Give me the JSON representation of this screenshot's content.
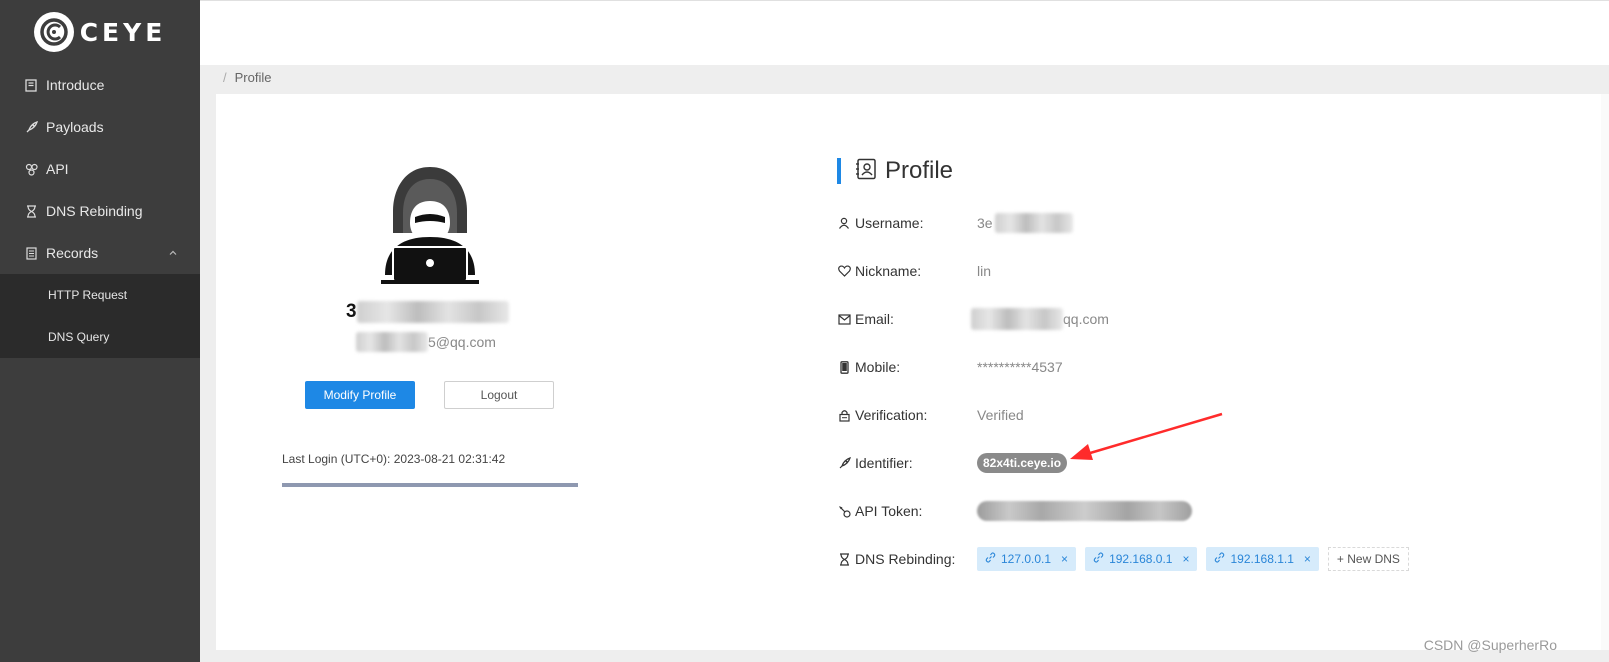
{
  "app": {
    "logo_text": "CEYE"
  },
  "sidebar": {
    "items": [
      {
        "label": "Introduce",
        "icon": "book-icon"
      },
      {
        "label": "Payloads",
        "icon": "rocket-icon"
      },
      {
        "label": "API",
        "icon": "api-icon"
      },
      {
        "label": "DNS Rebinding",
        "icon": "hourglass-icon"
      },
      {
        "label": "Records",
        "icon": "list-icon",
        "expanded": true
      }
    ],
    "subitems": [
      {
        "label": "HTTP Request"
      },
      {
        "label": "DNS Query"
      }
    ]
  },
  "breadcrumb": {
    "separator": "/",
    "current": "Profile"
  },
  "profile_card": {
    "name_visible": "3",
    "email_visible": "5@qq.com",
    "modify_button": "Modify Profile",
    "logout_button": "Logout",
    "last_login": "Last Login (UTC+0): 2023-08-21 02:31:42"
  },
  "profile_info": {
    "title": "Profile",
    "rows": {
      "username": {
        "label": "Username:",
        "value": "3e"
      },
      "nickname": {
        "label": "Nickname:",
        "value": "lin"
      },
      "email": {
        "label": "Email:",
        "value": "qq.com"
      },
      "mobile": {
        "label": "Mobile:",
        "value": "**********4537"
      },
      "verification": {
        "label": "Verification:",
        "value": "Verified"
      },
      "identifier": {
        "label": "Identifier:",
        "value": "82x4ti.ceye.io"
      },
      "api_token": {
        "label": "API Token:"
      },
      "dns_rebinding": {
        "label": "DNS Rebinding:"
      }
    },
    "dns_tags": [
      "127.0.0.1",
      "192.168.0.1",
      "192.168.1.1"
    ],
    "new_dns": "+ New DNS",
    "close_glyph": "×"
  },
  "watermark": "CSDN @SuperherRo",
  "colors": {
    "sidebar": "#3d3d3d",
    "accent": "#1e88e5",
    "annotation_arrow": "#ff2b2b"
  }
}
